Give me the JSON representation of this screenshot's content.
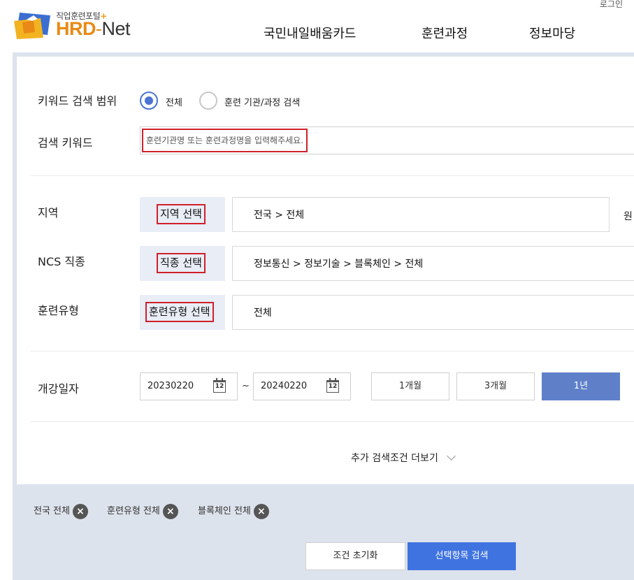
{
  "header": {
    "login": "로그인",
    "logo_sub": "직업훈련포털",
    "logo_plus": "+",
    "logo_hrd": "HRD",
    "logo_dash": "-",
    "logo_net": "Net",
    "nav": [
      "국민내일배움카드",
      "훈련과정",
      "정보마당"
    ]
  },
  "search": {
    "scope_label": "키워드 검색 범위",
    "scope_options": [
      "전체",
      "훈련 기관/과정 검색"
    ],
    "scope_selected": "전체",
    "keyword_label": "검색 키워드",
    "keyword_placeholder": "훈련기관명 또는 훈련과정명을 입력해주세요.",
    "keyword_value": "",
    "region_label": "지역",
    "region_button": "지역 선택",
    "region_value": "전국 > 전체",
    "region_side": "원",
    "ncs_label": "NCS 직종",
    "ncs_button": "직종 선택",
    "ncs_value": "정보통신 > 정보기술 > 블록체인 > 전체",
    "type_label": "훈련유형",
    "type_button": "훈련유형 선택",
    "type_value": "전체",
    "date_label": "개강일자",
    "date_start": "20230220",
    "date_end": "20240220",
    "date_tilde": "~",
    "calendar_text": "12",
    "periods": [
      "1개월",
      "3개월",
      "1년"
    ],
    "period_selected": "1년",
    "more_label": "추가 검색조건 더보기"
  },
  "tags": [
    "전국 전체",
    "훈련유형 전체",
    "블록체인 전체"
  ],
  "tag_remove": "×",
  "actions": {
    "reset": "조건 초기화",
    "search": "선택항목 검색"
  },
  "colors": {
    "accent": "#4a74d2",
    "highlight_border": "#d0202a",
    "search_button": "#3f73e0",
    "period_active": "#5f80c9",
    "panel_bg": "#dde3ec",
    "logo_orange": "#e88a15"
  }
}
